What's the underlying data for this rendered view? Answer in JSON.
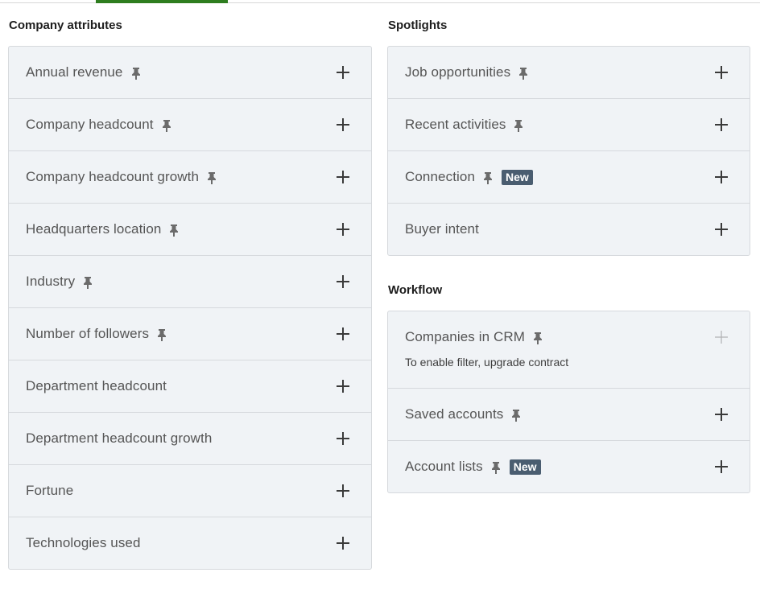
{
  "sections": {
    "company_attributes": {
      "title": "Company attributes",
      "items": [
        {
          "label": "Annual revenue",
          "pinned": true
        },
        {
          "label": "Company headcount",
          "pinned": true
        },
        {
          "label": "Company headcount growth",
          "pinned": true
        },
        {
          "label": "Headquarters location",
          "pinned": true
        },
        {
          "label": "Industry",
          "pinned": true
        },
        {
          "label": "Number of followers",
          "pinned": true
        },
        {
          "label": "Department headcount",
          "pinned": false
        },
        {
          "label": "Department headcount growth",
          "pinned": false
        },
        {
          "label": "Fortune",
          "pinned": false
        },
        {
          "label": "Technologies used",
          "pinned": false
        }
      ]
    },
    "spotlights": {
      "title": "Spotlights",
      "items": [
        {
          "label": "Job opportunities",
          "pinned": true
        },
        {
          "label": "Recent activities",
          "pinned": true
        },
        {
          "label": "Connection",
          "pinned": true,
          "badge": "New"
        },
        {
          "label": "Buyer intent",
          "pinned": false
        }
      ]
    },
    "workflow": {
      "title": "Workflow",
      "items": [
        {
          "label": "Companies in CRM",
          "pinned": true,
          "note": "To enable filter, upgrade contract",
          "disabled": true
        },
        {
          "label": "Saved accounts",
          "pinned": true
        },
        {
          "label": "Account lists",
          "pinned": true,
          "badge": "New"
        }
      ]
    }
  },
  "colors": {
    "active_tab": "#2e7d1f",
    "panel_bg": "#f0f3f6",
    "badge_bg": "#4a5d70"
  }
}
